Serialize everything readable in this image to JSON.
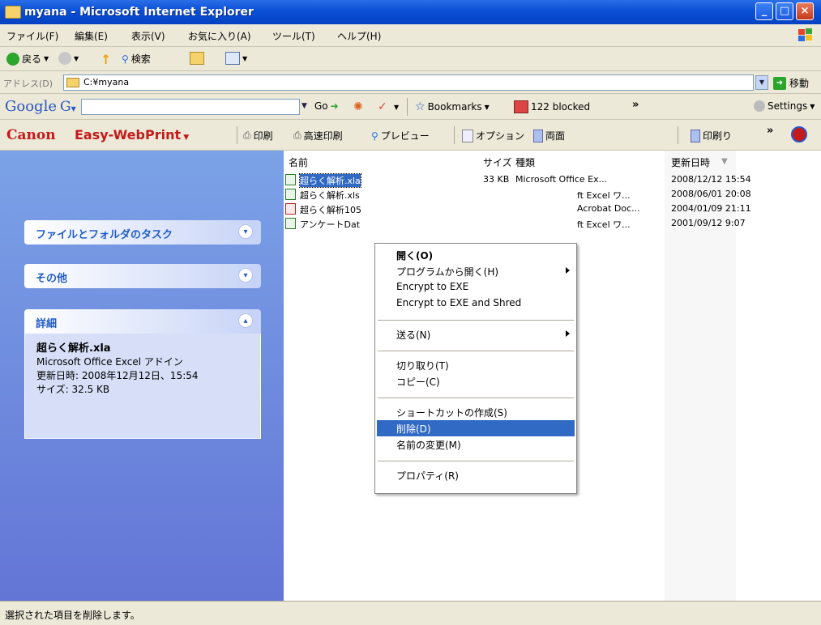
{
  "window": {
    "title": "myana - Microsoft Internet Explorer"
  },
  "menubar": {
    "items": [
      "ファイル(F)",
      "編集(E)",
      "表示(V)",
      "お気に入り(A)",
      "ツール(T)",
      "ヘルプ(H)"
    ]
  },
  "toolbar": {
    "back_label": "戻る",
    "search_label": "検索"
  },
  "address": {
    "label": "アドレス(D)",
    "value": "C:¥myana",
    "go_label": "移動"
  },
  "google": {
    "logo": "Google",
    "g_label": "G",
    "go_label": "Go",
    "bookmarks_label": "Bookmarks",
    "blocked_label": "122 blocked",
    "more": "»",
    "settings_label": "Settings"
  },
  "canon": {
    "logo": "Canon",
    "product": "Easy-WebPrint",
    "print": "印刷",
    "fast_print": "高速印刷",
    "preview": "プレビュー",
    "options": "オプション",
    "duplex": "両面",
    "print_trim": "印刷り",
    "more": "»"
  },
  "tasks": {
    "file_folder": "ファイルとフォルダのタスク",
    "other": "その他",
    "details": "詳細",
    "details_name": "超らく解析.xla",
    "details_type": "Microsoft Office Excel アドイン",
    "details_modified": "更新日時: 2008年12月12日、15:54",
    "details_size": "サイズ: 32.5 KB"
  },
  "filelist": {
    "columns": {
      "name": "名前",
      "size": "サイズ",
      "type": "種類",
      "modified": "更新日時"
    },
    "rows": [
      {
        "name": "超らく解析.xla",
        "size": "33 KB",
        "type": "Microsoft Office Ex...",
        "modified": "2008/12/12 15:54"
      },
      {
        "name": "超らく解析.xls",
        "size": "",
        "type": "ft Excel ワ...",
        "modified": "2008/06/01 20:08"
      },
      {
        "name": "超らく解析105",
        "size": "",
        "type": "Acrobat Doc...",
        "modified": "2004/01/09 21:11"
      },
      {
        "name": "アンケートDat",
        "size": "",
        "type": "ft Excel ワ...",
        "modified": "2001/09/12 9:07"
      }
    ]
  },
  "context_menu": {
    "open": "開く(O)",
    "open_with": "プログラムから開く(H)",
    "encrypt": "Encrypt to EXE",
    "encrypt_shred": "Encrypt to EXE and Shred",
    "send_to": "送る(N)",
    "cut": "切り取り(T)",
    "copy": "コピー(C)",
    "shortcut": "ショートカットの作成(S)",
    "delete": "削除(D)",
    "rename": "名前の変更(M)",
    "properties": "プロパティ(R)"
  },
  "status": {
    "text": "選択された項目を削除します。"
  },
  "colors": {
    "titlebar": "#0a4fd6",
    "selection": "#316ac5",
    "taskpane": "#6375d6",
    "canon_red": "#c31a1a"
  }
}
